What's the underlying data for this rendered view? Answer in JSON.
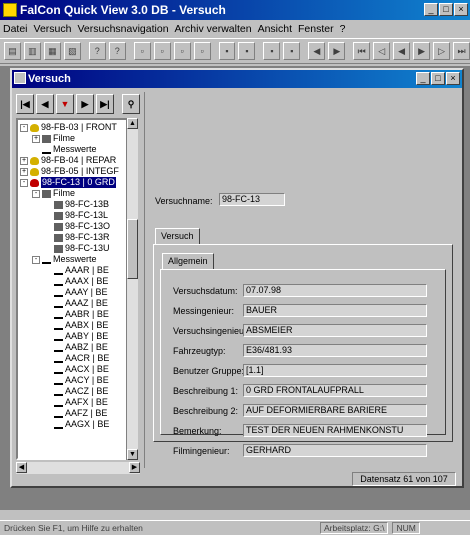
{
  "app": {
    "title": "FalCon Quick View 3.0 DB - Versuch"
  },
  "menu": [
    "Datei",
    "Versuch",
    "Versuchsnavigation",
    "Archiv verwalten",
    "Ansicht",
    "Fenster",
    "?"
  ],
  "child": {
    "title": "Versuch"
  },
  "tree": [
    {
      "indent": 0,
      "exp": "-",
      "icon": "bulb",
      "label": "98-FB-03 | FRONT"
    },
    {
      "indent": 1,
      "exp": "+",
      "icon": "film",
      "label": "Filme"
    },
    {
      "indent": 1,
      "exp": "",
      "icon": "wave",
      "label": "Messwerte"
    },
    {
      "indent": 0,
      "exp": "+",
      "icon": "bulb",
      "label": "98-FB-04 | REPAR"
    },
    {
      "indent": 0,
      "exp": "+",
      "icon": "bulb",
      "label": "98-FB-05 | INTEGF"
    },
    {
      "indent": 0,
      "exp": "-",
      "icon": "bulb-red",
      "label": "98-FC-13 | 0 GRD",
      "selected": true
    },
    {
      "indent": 1,
      "exp": "-",
      "icon": "film",
      "label": "Filme"
    },
    {
      "indent": 2,
      "exp": "",
      "icon": "film",
      "label": "98-FC-13B"
    },
    {
      "indent": 2,
      "exp": "",
      "icon": "film",
      "label": "98-FC-13L"
    },
    {
      "indent": 2,
      "exp": "",
      "icon": "film",
      "label": "98-FC-13O"
    },
    {
      "indent": 2,
      "exp": "",
      "icon": "film",
      "label": "98-FC-13R"
    },
    {
      "indent": 2,
      "exp": "",
      "icon": "film",
      "label": "98-FC-13U"
    },
    {
      "indent": 1,
      "exp": "-",
      "icon": "wave",
      "label": "Messwerte"
    },
    {
      "indent": 2,
      "exp": "",
      "icon": "wave",
      "label": "AAAR | BE"
    },
    {
      "indent": 2,
      "exp": "",
      "icon": "wave",
      "label": "AAAX | BE"
    },
    {
      "indent": 2,
      "exp": "",
      "icon": "wave",
      "label": "AAAY | BE"
    },
    {
      "indent": 2,
      "exp": "",
      "icon": "wave",
      "label": "AAAZ | BE"
    },
    {
      "indent": 2,
      "exp": "",
      "icon": "wave",
      "label": "AABR | BE"
    },
    {
      "indent": 2,
      "exp": "",
      "icon": "wave",
      "label": "AABX | BE"
    },
    {
      "indent": 2,
      "exp": "",
      "icon": "wave",
      "label": "AABY | BE"
    },
    {
      "indent": 2,
      "exp": "",
      "icon": "wave",
      "label": "AABZ | BE"
    },
    {
      "indent": 2,
      "exp": "",
      "icon": "wave",
      "label": "AACR | BE"
    },
    {
      "indent": 2,
      "exp": "",
      "icon": "wave",
      "label": "AACX | BE"
    },
    {
      "indent": 2,
      "exp": "",
      "icon": "wave",
      "label": "AACY | BE"
    },
    {
      "indent": 2,
      "exp": "",
      "icon": "wave",
      "label": "AACZ | BE"
    },
    {
      "indent": 2,
      "exp": "",
      "icon": "wave",
      "label": "AAFX | BE"
    },
    {
      "indent": 2,
      "exp": "",
      "icon": "wave",
      "label": "AAFZ | BE"
    },
    {
      "indent": 2,
      "exp": "",
      "icon": "wave",
      "label": "AAGX | BE"
    }
  ],
  "detail": {
    "versuchname_label": "Versuchname:",
    "versuchname_value": "98-FC-13",
    "tab_outer": "Versuch",
    "tab_inner": "Allgemein",
    "fields": [
      {
        "label": "Versuchsdatum:",
        "value": "07.07.98"
      },
      {
        "label": "Messingenieur:",
        "value": "BAUER"
      },
      {
        "label": "Versuchsingenieur:",
        "value": "ABSMEIER"
      },
      {
        "label": "Fahrzeugtyp:",
        "value": "E36/481.93"
      },
      {
        "label": "Benutzer Gruppe:",
        "value": "[1.1]"
      },
      {
        "label": "Beschreibung 1:",
        "value": "0 GRD FRONTALAUFPRALL"
      },
      {
        "label": "Beschreibung 2:",
        "value": "AUF DEFORMIERBARE BARIERE"
      },
      {
        "label": "Bemerkung:",
        "value": "TEST DER NEUEN RAHMENKONSTU"
      },
      {
        "label": "Filmingenieur:",
        "value": "GERHARD"
      }
    ],
    "record": "Datensatz 61 von 107"
  },
  "status": {
    "hint": "Drücken Sie F1, um Hilfe zu erhalten",
    "workspace": "Arbeitsplatz: G:\\",
    "num": "NUM"
  }
}
